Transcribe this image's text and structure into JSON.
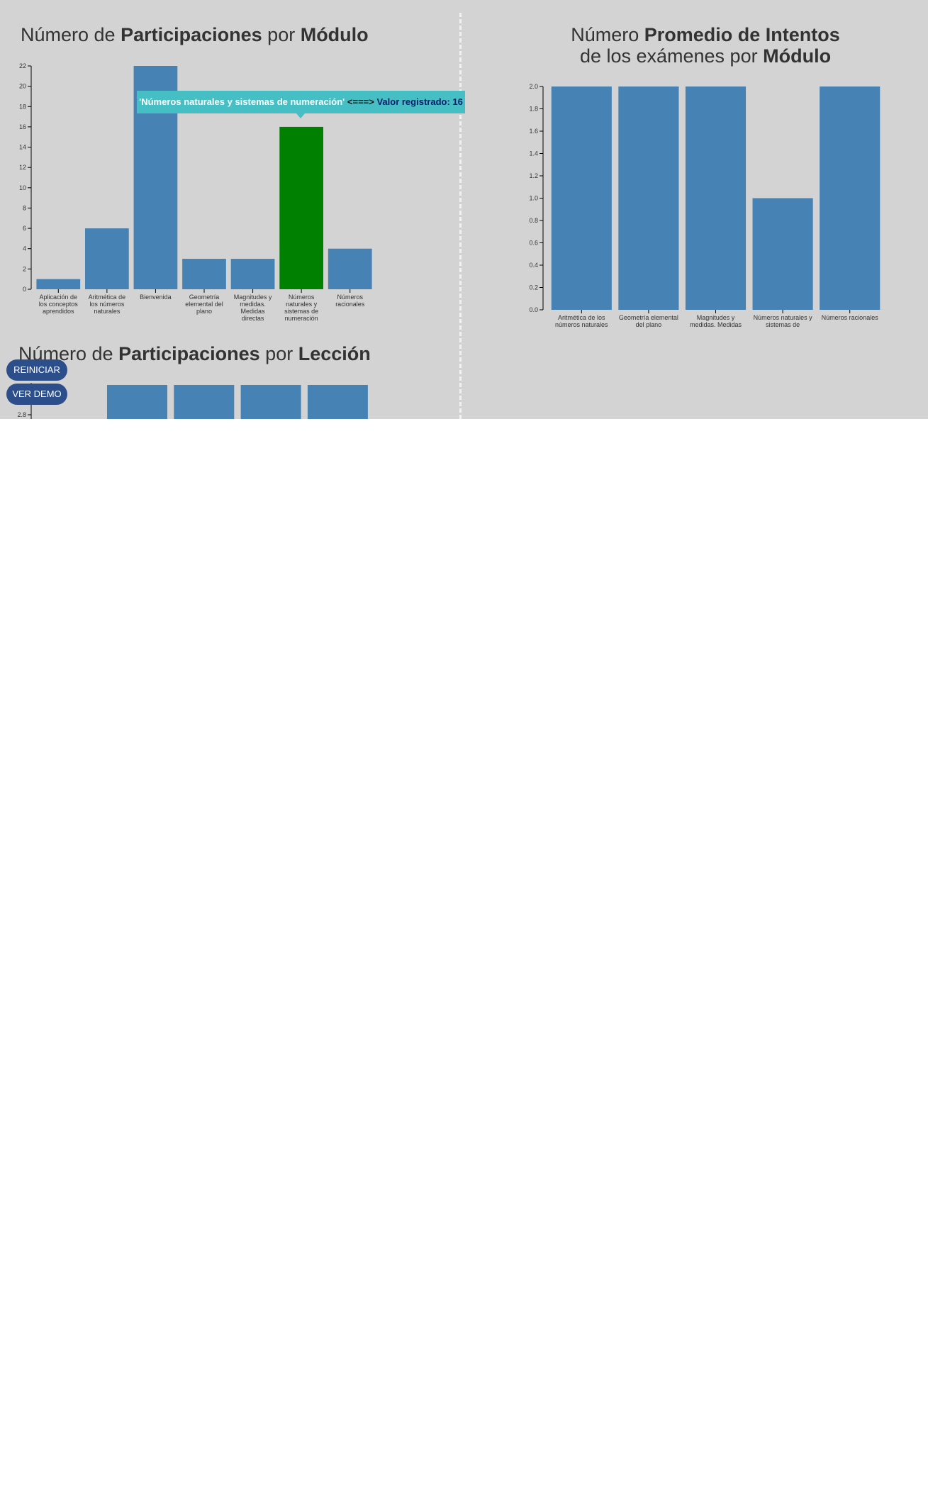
{
  "titles": {
    "chart1": {
      "pre": "Número de ",
      "b1": "Participaciones",
      "mid": " por ",
      "b2": "Módulo"
    },
    "chart2": {
      "pre": "Número ",
      "b1": "Promedio de Intentos",
      "mid": "de los exámenes por ",
      "b2": "Módulo"
    },
    "chart3": {
      "pre": "Número de ",
      "b1": "Participaciones",
      "mid": " por ",
      "b2": "Lección"
    }
  },
  "tooltip": {
    "name": "'Números naturales y sistemas de numeración'",
    "arrow": " <===> ",
    "value_label": "Valor registrado: 16"
  },
  "buttons": {
    "reset": "REINICIAR",
    "demo": "VER DEMO"
  },
  "colors": {
    "bar": "#4682b4",
    "highlight": "#008000",
    "tooltip": "#45bfc4",
    "background": "#d3d3d3",
    "button": "#2c4f8c"
  },
  "chart_data": [
    {
      "type": "bar",
      "categories": [
        [
          "Aplicación de",
          "los conceptos",
          "aprendidos"
        ],
        [
          "Aritmética de",
          "los números",
          "naturales"
        ],
        [
          "Bienvenida"
        ],
        [
          "Geometría",
          "elemental del",
          "plano"
        ],
        [
          "Magnitudes y",
          "medidas.",
          "Medidas",
          "directas"
        ],
        [
          "Números",
          "naturales y",
          "sistemas de",
          "numeración"
        ],
        [
          "Números",
          "racionales"
        ]
      ],
      "values": [
        1,
        6,
        22,
        3,
        3,
        16,
        4
      ],
      "highlighted_index": 5,
      "ylim": [
        0,
        22
      ],
      "yticks": [
        "0",
        "2",
        "4",
        "6",
        "8",
        "10",
        "12",
        "14",
        "16",
        "18",
        "20",
        "22"
      ]
    },
    {
      "type": "bar",
      "categories": [
        [
          "Aritmética de los",
          "números naturales"
        ],
        [
          "Geometría elemental",
          "del plano"
        ],
        [
          "Magnitudes y",
          "medidas. Medidas"
        ],
        [
          "Números naturales y",
          "sistemas de"
        ],
        [
          "Números racionales"
        ]
      ],
      "values": [
        2,
        2,
        2,
        1,
        2
      ],
      "ylim": [
        0,
        2
      ],
      "yticks": [
        "0.0",
        "0.2",
        "0.4",
        "0.6",
        "0.8",
        "1.0",
        "1.2",
        "1.4",
        "1.6",
        "1.8",
        "2.0"
      ]
    },
    {
      "type": "bar",
      "categories": [],
      "visible_bar_count": 4,
      "yticks": [
        "2.8"
      ]
    }
  ]
}
